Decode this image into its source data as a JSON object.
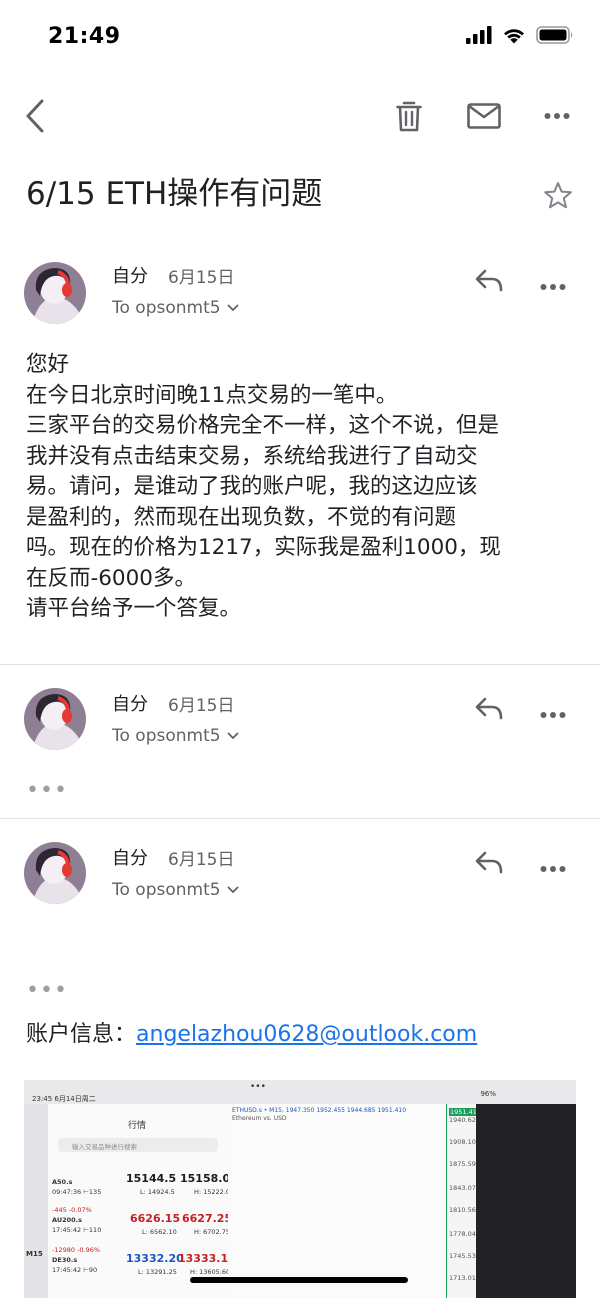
{
  "status_bar": {
    "time": "21:49"
  },
  "email": {
    "subject": "6/15 ETH操作有问题",
    "messages": [
      {
        "sender": "自分",
        "date": "6月15日",
        "recipient": "To opsonmt5"
      },
      {
        "sender": "自分",
        "date": "6月15日",
        "recipient": "To opsonmt5"
      },
      {
        "sender": "自分",
        "date": "6月15日",
        "recipient": "To opsonmt5"
      }
    ],
    "body_lines": [
      "您好",
      "在今日北京时间晚11点交易的一笔中。",
      "三家平台的交易价格完全不一样，这个不说，但是",
      "我并没有点击结束交易，系统给我进行了自动交",
      "易。请问，是谁动了我的账户呢，我的这边应该",
      "是盈利的，然而现在出现负数，不觉的有问题",
      "吗。现在的价格为1217，实际我是盈利1000，现",
      "在反而-6000多。",
      "请平台给予一个答复。"
    ],
    "collapsed_marker": "•••",
    "account_label": "账户信息：",
    "account_email": "angelazhou0628@outlook.com"
  },
  "attachment_screenshot": {
    "top_time": "23:45  6月14日周二",
    "battery": "96%",
    "panel_title": "行情",
    "search_placeholder": "输入交易品种进行搜索",
    "symbol_header": "ETHUSD.s • M15, 1947.350 1952.455 1944.685 1951.410",
    "symbol_sub": "Ethereum vs. USD",
    "quotes": [
      {
        "time_info": "09:47:36 ⊢135",
        "name": "A50.s",
        "bid": "15144.5",
        "ask": "15158.0",
        "low": "L: 14924.5",
        "high": "H: 15222.0",
        "change": ""
      },
      {
        "time_info": "17:45:42 ⊢110",
        "name": "AU200.s",
        "bid": "6626.15",
        "ask": "6627.25",
        "low": "L: 6562.10",
        "high": "H: 6702.75",
        "change": "-445 -0.07%"
      },
      {
        "time_info": "17:45:42 ⊢90",
        "name": "DE30.s",
        "bid": "13332.20",
        "ask": "13333.10",
        "low": "L: 13291.25",
        "high": "H: 13605.60",
        "change": "-12980 -0.96%"
      }
    ],
    "price_axis": [
      "1951.410",
      "1940.620",
      "1908.105",
      "1875.590",
      "1843.075",
      "1810.560",
      "1778.045",
      "1745.530",
      "1713.015"
    ],
    "timeframe": "M15"
  },
  "colors": {
    "link": "#1a73e8",
    "text": "#202124",
    "muted": "#5f6368",
    "quote_down": "#c5221f",
    "quote_up": "#1a56c5",
    "axis_green": "#1a9e5b"
  }
}
